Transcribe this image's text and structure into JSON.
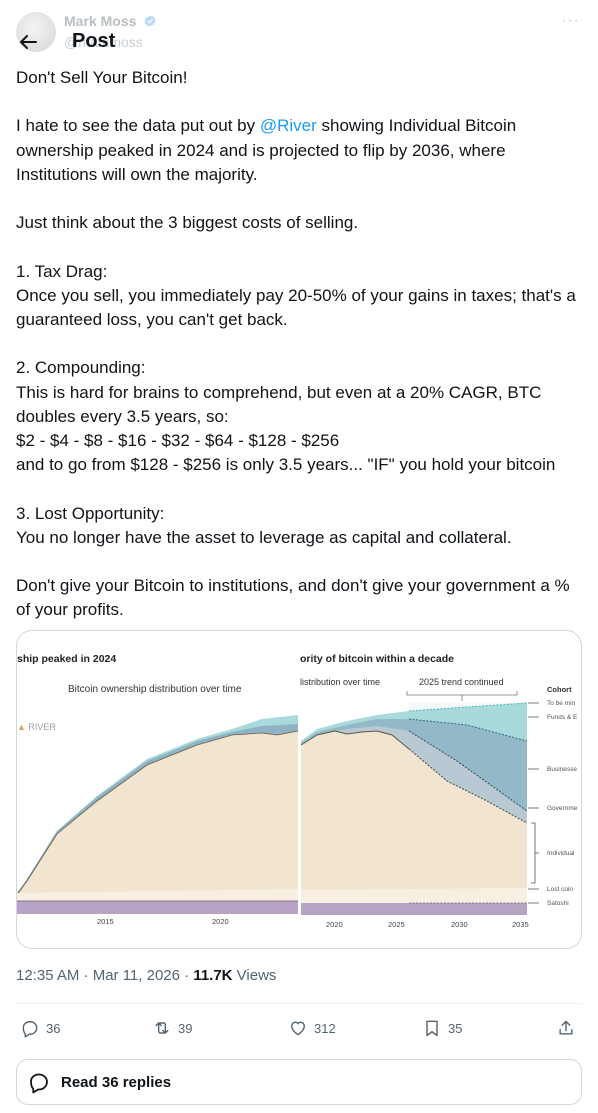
{
  "header": {
    "title": "Post",
    "author_name": "Mark Moss",
    "author_handle": "@markmoss",
    "more": "···"
  },
  "post": {
    "lines": {
      "l1": "Don't Sell Your Bitcoin!",
      "l2a": "I hate to see the data put out by ",
      "l2_mention": "@River",
      "l2b": " showing Individual Bitcoin ownership peaked in 2024 and is projected to flip by 2036, where Institutions will own the majority.",
      "l3": "Just think about the 3 biggest costs of selling.",
      "l4": "1. Tax Drag:",
      "l5": "Once you sell, you immediately pay 20-50% of your gains in taxes; that's a guaranteed loss, you can't get back.",
      "l6": "2. Compounding:",
      "l7": "This is hard for brains to comprehend, but even at a 20% CAGR, BTC doubles every 3.5 years, so:",
      "l8": "$2 - $4 - $8 - $16 - $32 - $64 - $128 - $256",
      "l9": "and to go from $128 - $256 is only 3.5 years... \"IF\" you hold your bitcoin",
      "l10": "3. Lost Opportunity:",
      "l11": "You no longer have the asset to leverage as capital and collateral.",
      "l12": "Don't give your Bitcoin to institutions, and don't give your government a % of your profits."
    }
  },
  "media": {
    "left_title": "ship peaked in 2024",
    "left_subtitle": "Bitcoin ownership distribution over time",
    "left_watermark": "RIVER",
    "right_title": "ority of bitcoin within a decade",
    "right_subtitle": "listribution over time",
    "right_trend": "2025 trend continued",
    "legend_title": "Cohort",
    "legend_items": [
      "To be min",
      "Funds & E",
      "Businesse",
      "Governme",
      "Individual",
      "Lost coin",
      "Satoshi"
    ],
    "left_ticks": [
      "2015",
      "2020"
    ],
    "right_ticks": [
      "2020",
      "2025",
      "2030",
      "2035"
    ],
    "colors": {
      "individuals": "#f2e5d0",
      "governments": "#b9c9d3",
      "businesses": "#8fb3c4",
      "funds": "#a8dadc",
      "satoshi": "#b7a3c4",
      "lost": "#f6efe2"
    }
  },
  "meta": {
    "time": "12:35 AM · Mar 11, 2026 · ",
    "views_count": "11.7K",
    "views_label": " Views"
  },
  "actions": {
    "replies": "36",
    "reposts": "39",
    "likes": "312",
    "bookmarks": "35"
  },
  "read_replies": "Read 36 replies"
}
